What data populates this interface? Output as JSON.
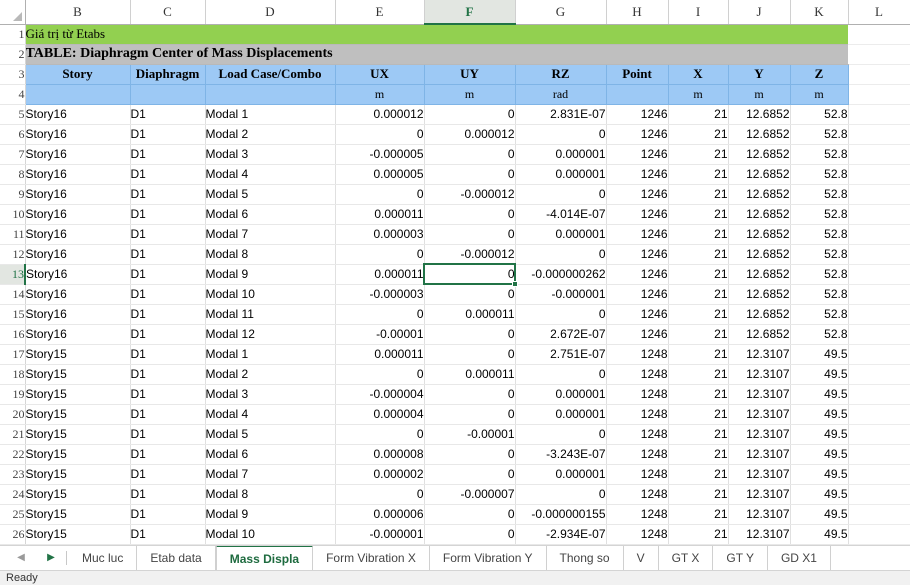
{
  "window": {
    "status_text": "Ready"
  },
  "grid": {
    "column_headers": [
      "B",
      "C",
      "D",
      "E",
      "F",
      "G",
      "H",
      "I",
      "J",
      "K",
      "L"
    ],
    "selected_column": "F",
    "selected_row": "13",
    "selected_cell": "F13",
    "row_numbers": [
      "1",
      "2",
      "3",
      "4",
      "5",
      "6",
      "7",
      "8",
      "9",
      "10",
      "11",
      "12",
      "13",
      "14",
      "15",
      "16",
      "17",
      "18",
      "19",
      "20",
      "21",
      "22",
      "23",
      "24",
      "25",
      "26"
    ],
    "banner_row1": "Giá trị từ Etabs",
    "banner_row2": "TABLE:  Diaphragm Center of Mass Displacements",
    "header_row": [
      "Story",
      "Diaphragm",
      "Load Case/Combo",
      "UX",
      "UY",
      "RZ",
      "Point",
      "X",
      "Y",
      "Z"
    ],
    "unit_row": [
      "",
      "",
      "",
      "m",
      "m",
      "rad",
      "",
      "m",
      "m",
      "m"
    ],
    "rows": [
      [
        "Story16",
        "D1",
        "Modal 1",
        "0.000012",
        "0",
        "2.831E-07",
        "1246",
        "21",
        "12.6852",
        "52.8"
      ],
      [
        "Story16",
        "D1",
        "Modal 2",
        "0",
        "0.000012",
        "0",
        "1246",
        "21",
        "12.6852",
        "52.8"
      ],
      [
        "Story16",
        "D1",
        "Modal 3",
        "-0.000005",
        "0",
        "0.000001",
        "1246",
        "21",
        "12.6852",
        "52.8"
      ],
      [
        "Story16",
        "D1",
        "Modal 4",
        "0.000005",
        "0",
        "0.000001",
        "1246",
        "21",
        "12.6852",
        "52.8"
      ],
      [
        "Story16",
        "D1",
        "Modal 5",
        "0",
        "-0.000012",
        "0",
        "1246",
        "21",
        "12.6852",
        "52.8"
      ],
      [
        "Story16",
        "D1",
        "Modal 6",
        "0.000011",
        "0",
        "-4.014E-07",
        "1246",
        "21",
        "12.6852",
        "52.8"
      ],
      [
        "Story16",
        "D1",
        "Modal 7",
        "0.000003",
        "0",
        "0.000001",
        "1246",
        "21",
        "12.6852",
        "52.8"
      ],
      [
        "Story16",
        "D1",
        "Modal 8",
        "0",
        "-0.000012",
        "0",
        "1246",
        "21",
        "12.6852",
        "52.8"
      ],
      [
        "Story16",
        "D1",
        "Modal 9",
        "0.000011",
        "0",
        "-0.000000262",
        "1246",
        "21",
        "12.6852",
        "52.8"
      ],
      [
        "Story16",
        "D1",
        "Modal 10",
        "-0.000003",
        "0",
        "-0.000001",
        "1246",
        "21",
        "12.6852",
        "52.8"
      ],
      [
        "Story16",
        "D1",
        "Modal 11",
        "0",
        "0.000011",
        "0",
        "1246",
        "21",
        "12.6852",
        "52.8"
      ],
      [
        "Story16",
        "D1",
        "Modal 12",
        "-0.00001",
        "0",
        "2.672E-07",
        "1246",
        "21",
        "12.6852",
        "52.8"
      ],
      [
        "Story15",
        "D1",
        "Modal 1",
        "0.000011",
        "0",
        "2.751E-07",
        "1248",
        "21",
        "12.3107",
        "49.5"
      ],
      [
        "Story15",
        "D1",
        "Modal 2",
        "0",
        "0.000011",
        "0",
        "1248",
        "21",
        "12.3107",
        "49.5"
      ],
      [
        "Story15",
        "D1",
        "Modal 3",
        "-0.000004",
        "0",
        "0.000001",
        "1248",
        "21",
        "12.3107",
        "49.5"
      ],
      [
        "Story15",
        "D1",
        "Modal 4",
        "0.000004",
        "0",
        "0.000001",
        "1248",
        "21",
        "12.3107",
        "49.5"
      ],
      [
        "Story15",
        "D1",
        "Modal 5",
        "0",
        "-0.00001",
        "0",
        "1248",
        "21",
        "12.3107",
        "49.5"
      ],
      [
        "Story15",
        "D1",
        "Modal 6",
        "0.000008",
        "0",
        "-3.243E-07",
        "1248",
        "21",
        "12.3107",
        "49.5"
      ],
      [
        "Story15",
        "D1",
        "Modal 7",
        "0.000002",
        "0",
        "0.000001",
        "1248",
        "21",
        "12.3107",
        "49.5"
      ],
      [
        "Story15",
        "D1",
        "Modal 8",
        "0",
        "-0.000007",
        "0",
        "1248",
        "21",
        "12.3107",
        "49.5"
      ],
      [
        "Story15",
        "D1",
        "Modal 9",
        "0.000006",
        "0",
        "-0.000000155",
        "1248",
        "21",
        "12.3107",
        "49.5"
      ],
      [
        "Story15",
        "D1",
        "Modal 10",
        "-0.000001",
        "0",
        "-2.934E-07",
        "1248",
        "21",
        "12.3107",
        "49.5"
      ]
    ]
  },
  "sheet_tabs": {
    "first_icon": "nav-first-icon",
    "prev_icon": "nav-prev-icon",
    "tabs": [
      {
        "label": "Muc luc",
        "active": false
      },
      {
        "label": "Etab data",
        "active": false
      },
      {
        "label": "Mass Displa",
        "active": true
      },
      {
        "label": "Form Vibration X",
        "active": false
      },
      {
        "label": "Form Vibration Y",
        "active": false
      },
      {
        "label": "Thong so",
        "active": false
      },
      {
        "label": "V",
        "active": false
      },
      {
        "label": "GT X",
        "active": false
      },
      {
        "label": "GT Y",
        "active": false
      },
      {
        "label": "GD X1",
        "active": false
      }
    ]
  },
  "colors": {
    "banner_green": "#92d050",
    "banner_gray": "#bfbfbf",
    "header_blue": "#9dc9f5",
    "accent_green": "#217346"
  }
}
